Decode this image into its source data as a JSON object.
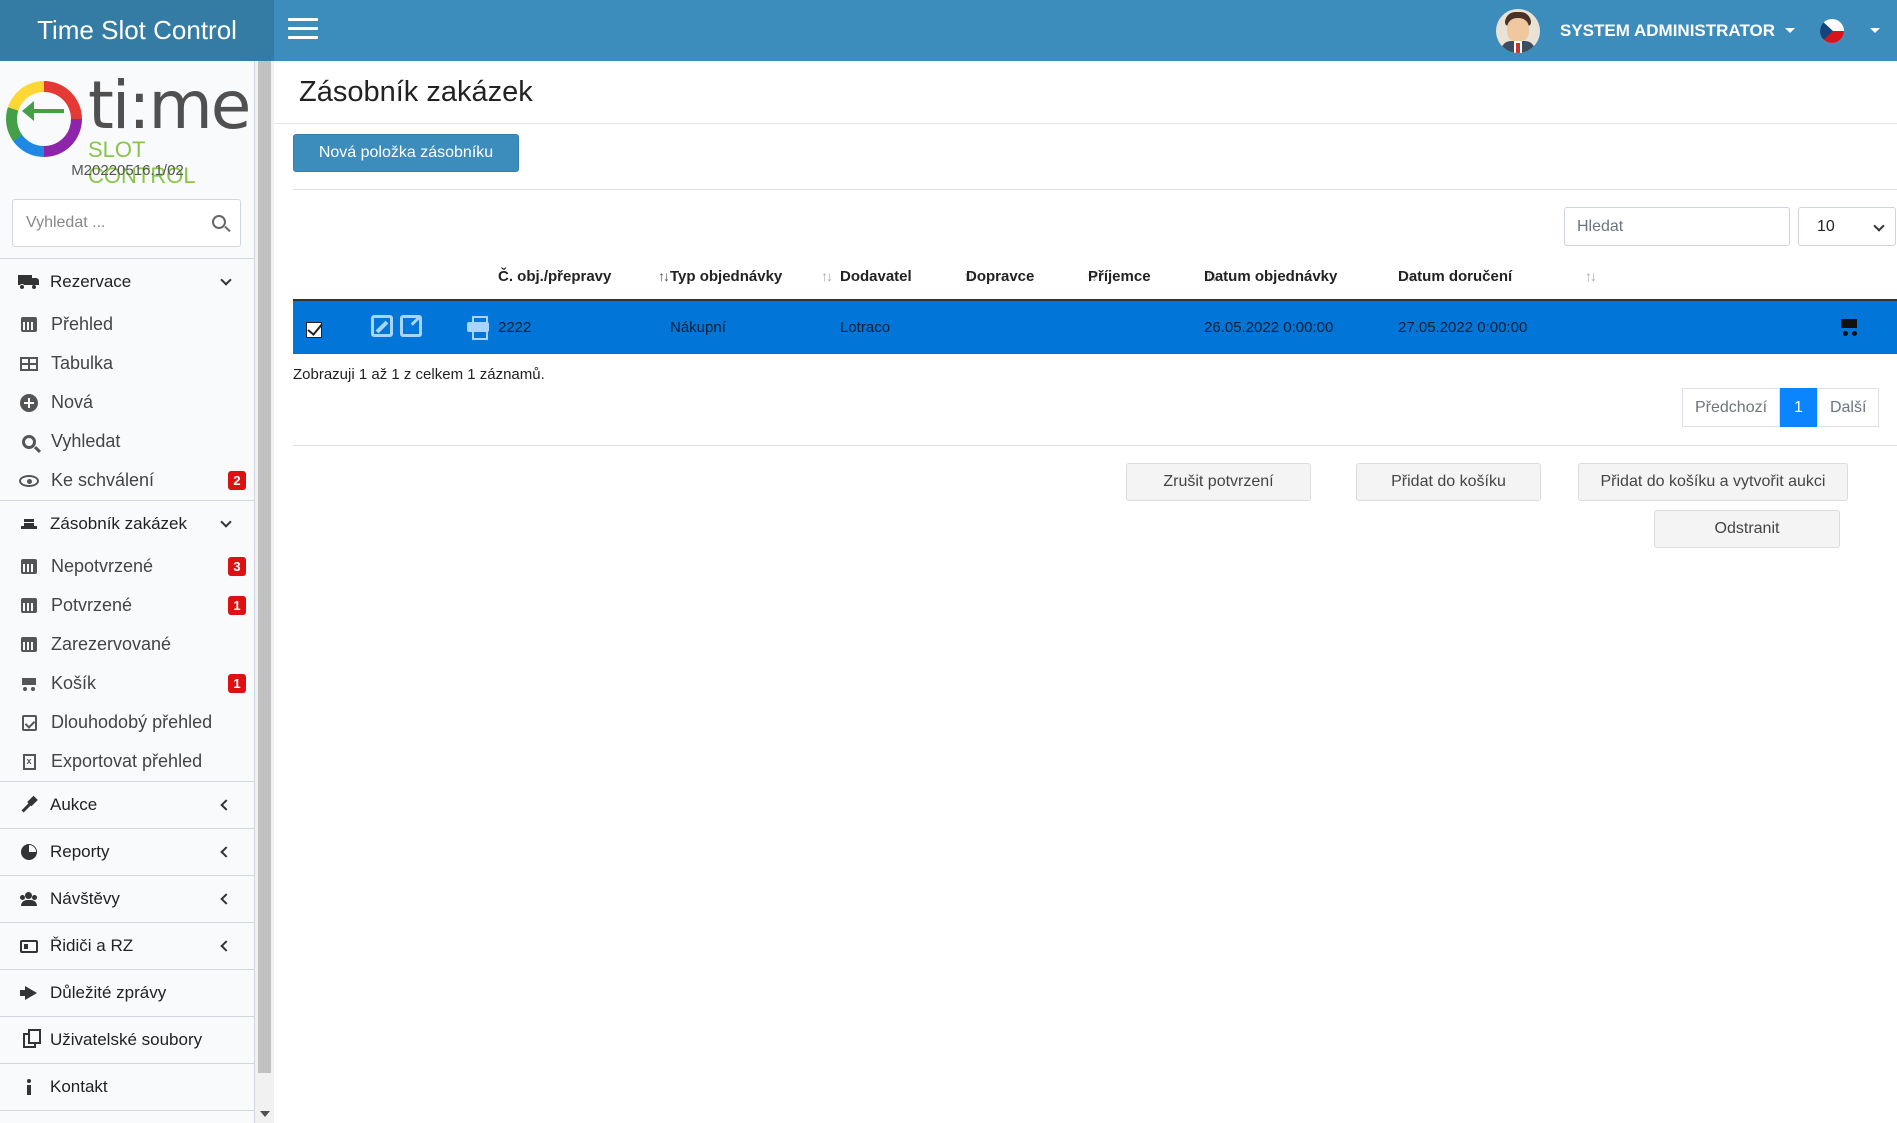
{
  "app": {
    "title": "Time Slot Control",
    "version": "M20220516.1/02"
  },
  "logo": {
    "main": "ti:me",
    "sub": "SLOT CONTROL"
  },
  "header": {
    "user_name": "SYSTEM ADMINISTRATOR",
    "language": "cs"
  },
  "sidebar": {
    "search_placeholder": "Vyhledat ...",
    "groups": [
      {
        "label": "Rezervace",
        "icon": "truck-icon",
        "expanded": true,
        "items": [
          {
            "label": "Přehled",
            "icon": "calendar-icon"
          },
          {
            "label": "Tabulka",
            "icon": "table-icon"
          },
          {
            "label": "Nová",
            "icon": "plus-circle-icon"
          },
          {
            "label": "Vyhledat",
            "icon": "search-icon"
          },
          {
            "label": "Ke schválení",
            "icon": "eye-icon",
            "badge": "2"
          }
        ]
      },
      {
        "label": "Zásobník zakázek",
        "icon": "stack-icon",
        "expanded": true,
        "items": [
          {
            "label": "Nepotvrzené",
            "icon": "calendar-icon",
            "badge": "3"
          },
          {
            "label": "Potvrzené",
            "icon": "calendar-icon",
            "badge": "1"
          },
          {
            "label": "Zarezervované",
            "icon": "calendar-icon"
          },
          {
            "label": "Košík",
            "icon": "cart-icon",
            "badge": "1"
          },
          {
            "label": "Dlouhodobý přehled",
            "icon": "calendar-check-icon"
          },
          {
            "label": "Exportovat přehled",
            "icon": "file-excel-icon"
          }
        ]
      },
      {
        "label": "Aukce",
        "icon": "gavel-icon",
        "expanded": false
      },
      {
        "label": "Reporty",
        "icon": "pie-chart-icon",
        "expanded": false
      },
      {
        "label": "Návštěvy",
        "icon": "users-icon",
        "expanded": false
      },
      {
        "label": "Řidiči a RZ",
        "icon": "id-card-icon",
        "expanded": false
      },
      {
        "label": "Důležité zprávy",
        "icon": "megaphone-icon"
      },
      {
        "label": "Uživatelské soubory",
        "icon": "copy-icon"
      },
      {
        "label": "Kontakt",
        "icon": "info-icon"
      }
    ]
  },
  "main": {
    "title": "Zásobník zakázek",
    "new_button": "Nová položka zásobníku",
    "filter_placeholder": "Hledat",
    "page_length": "10",
    "columns": [
      "Č. obj./přepravy",
      "Typ objednávky",
      "Dodavatel",
      "Dopravce",
      "Příjemce",
      "Datum objednávky",
      "Datum doručení"
    ],
    "rows": [
      {
        "order_no": "2222",
        "type": "Nákupní",
        "supplier": "Lotraco",
        "carrier": "",
        "recipient": "",
        "order_date": "26.05.2022 0:00:00",
        "delivery_date": "27.05.2022 0:00:00",
        "selected": true
      }
    ],
    "info": "Zobrazuji 1 až 1 z celkem 1 záznamů.",
    "pagination": {
      "prev": "Předchozí",
      "current": "1",
      "next": "Další"
    },
    "actions": {
      "cancel_confirm": "Zrušit potvrzení",
      "add_to_cart": "Přidat do košíku",
      "add_to_cart_auction": "Přidat do košíku a vytvořit aukci",
      "remove": "Odstranit"
    }
  },
  "colors": {
    "header": "#3c8dbc",
    "brand": "#357ca5",
    "selected_row": "#0275d8",
    "badge": "#dd1111"
  }
}
